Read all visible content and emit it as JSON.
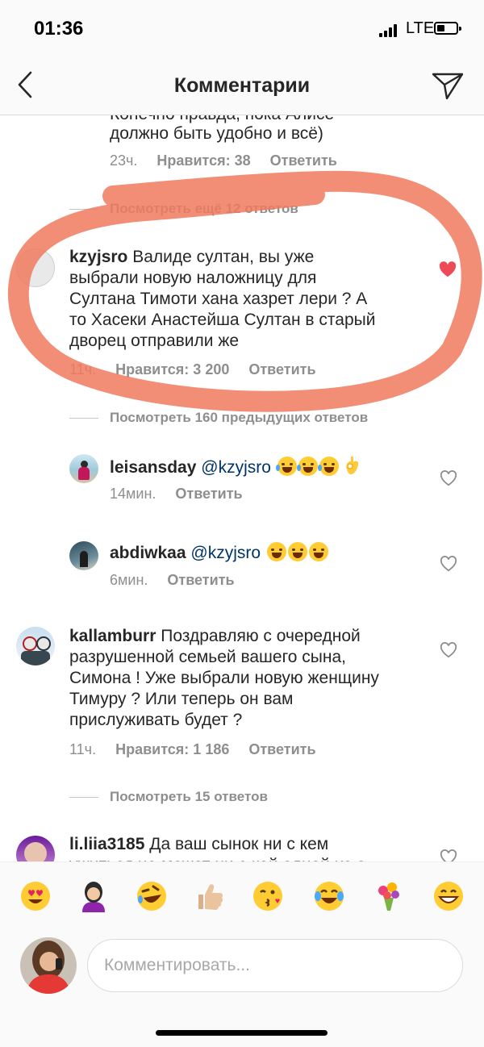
{
  "status_bar": {
    "time": "01:36",
    "network": "LTE"
  },
  "header": {
    "title": "Комментарии"
  },
  "comments": {
    "top_partial": {
      "line1": "Конечно правда, пока Алисе",
      "line2": "должно быть удобно и всё)",
      "time": "23ч.",
      "likes": "Нравится: 38",
      "reply": "Ответить"
    },
    "view_more_1": "Посмотреть ещё 12 ответов",
    "c1": {
      "username": "kzyjsro",
      "line1": "Валиде султан, вы уже",
      "line2": "выбрали новую наложницу для",
      "line3": "Султана Тимоти хана хазрет лери ? А",
      "line4": "то Хасеки Анастейша Султан в старый",
      "line5": "дворец отправили же",
      "time": "11ч.",
      "likes": "Нравится: 3 200",
      "reply": "Ответить"
    },
    "view_more_2": "Посмотреть 160 предыдущих ответов",
    "r1": {
      "username": "leisansday",
      "mention": "@kzyjsro",
      "time": "14мин.",
      "reply": "Ответить"
    },
    "r2": {
      "username": "abdiwkaa",
      "mention": "@kzyjsro",
      "time": "6мин.",
      "reply": "Ответить"
    },
    "c2": {
      "username": "kallamburr",
      "line1": "Поздравляю с очередной",
      "line2": "разрушенной семьей вашего сына,",
      "line3": "Симона ! Уже выбрали новую женщину",
      "line4": "Тимуру ? Или теперь он вам",
      "line5": "прислуживать будет ?",
      "time": "11ч.",
      "likes": "Нравится: 1 186",
      "reply": "Ответить"
    },
    "view_more_3": "Посмотреть 15 ответов",
    "c3": {
      "username": "li.liia3185",
      "line1": "Да ваш сынок ни с кем",
      "line2": "ужиться не может ни с кой одной из о"
    }
  },
  "emoji_bar": [
    "heart-eyes-emoji",
    "woman-emoji",
    "rofl-emoji",
    "thumbs-up-emoji",
    "kissing-emoji",
    "joy-emoji",
    "bouquet-emoji",
    "grinning-emoji"
  ],
  "composer": {
    "placeholder": "Комментировать..."
  },
  "colors": {
    "heart_red": "#ed4956",
    "scribble": "#f07a5e",
    "muted": "#8e8e8e"
  }
}
